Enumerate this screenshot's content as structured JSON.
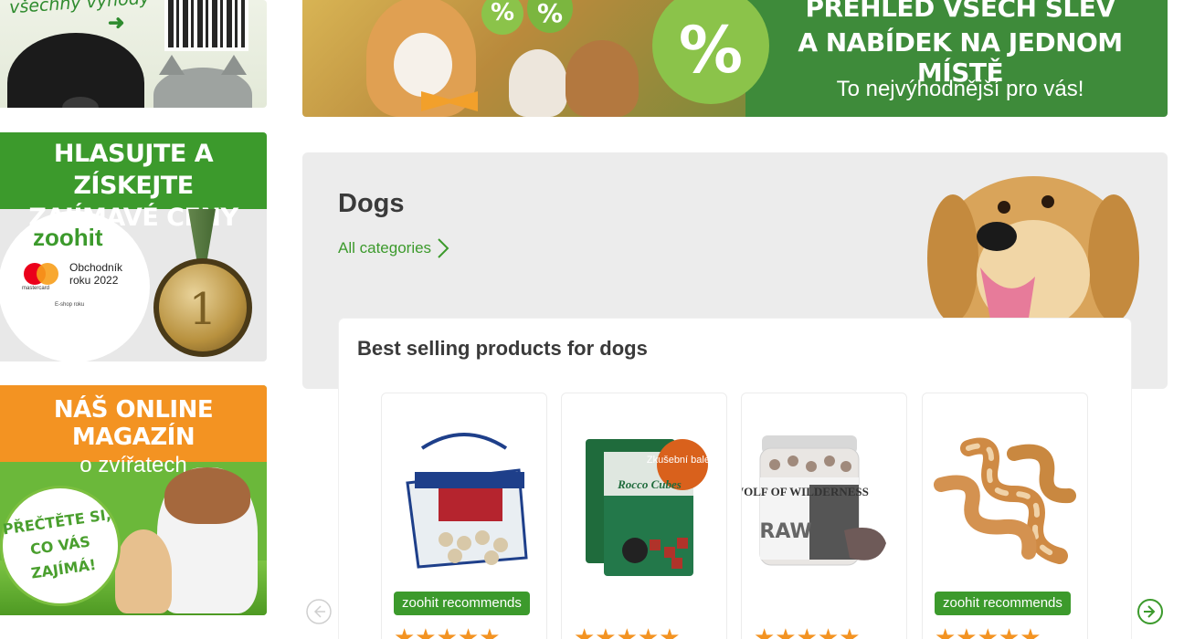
{
  "sidebar": {
    "banner1": {
      "text": "všechny výhody"
    },
    "banner2": {
      "heading_line1": "HLASUJTE A ZÍSKEJTE",
      "heading_line2": "ZAJÍMAVÉ CENY",
      "logo": "zoohit",
      "award_line1": "Obchodník",
      "award_line2": "roku 2022",
      "mastercard": "mastercard",
      "eshop": "E-shop roku",
      "medal_number": "1"
    },
    "banner3": {
      "heading_line1": "NÁŠ ONLINE MAGAZÍN",
      "heading_line2": "o zvířatech",
      "bubble_line1": "PŘEČTĚTE SI,",
      "bubble_line2": "CO VÁS",
      "bubble_line3": "ZAJÍMÁ!"
    }
  },
  "top_banner": {
    "line1": "PŘEHLED VŠECH SLEV",
    "line2": "A NABÍDEK NA JEDNOM MÍSTĚ",
    "line3": "To nejvýhodnější pro vás!",
    "percent": "%"
  },
  "dogs": {
    "title": "Dogs",
    "all_categories": "All categories"
  },
  "best_sellers": {
    "title": "Best selling products for dogs",
    "products": [
      {
        "badge": "zoohit recommends",
        "rating": 5
      },
      {
        "badge": "",
        "rating": 5,
        "tag": "Zkušební balení",
        "brand": "Rocco Cubes"
      },
      {
        "badge": "",
        "rating": 5,
        "brand": "WOLF OF WILDERNESS",
        "sub": "RAW"
      },
      {
        "badge": "zoohit recommends",
        "rating": 5
      }
    ]
  },
  "colors": {
    "brand_green": "#3c9a2c",
    "accent_orange": "#f39322",
    "banner_green": "#3e8b3a"
  },
  "icons": {
    "prev": "chevron-left-circle-icon",
    "next": "chevron-right-circle-icon",
    "all_categories": "chevron-right-icon"
  }
}
